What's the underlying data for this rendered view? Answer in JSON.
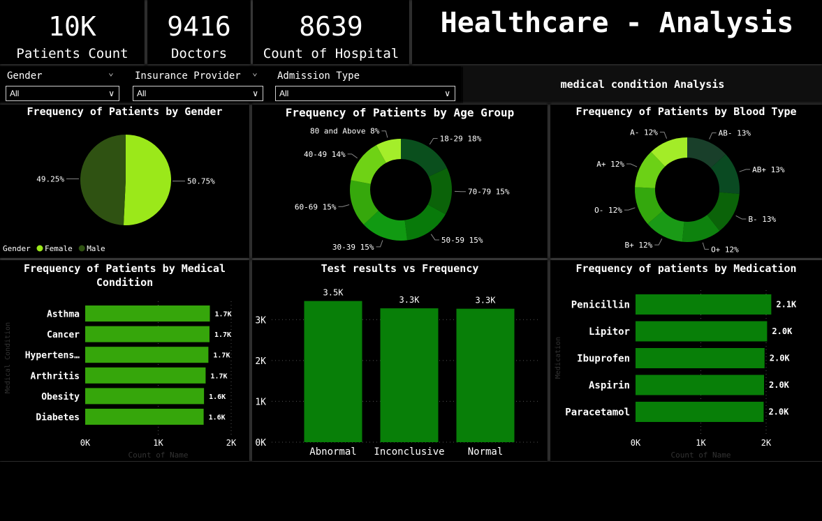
{
  "kpis": [
    {
      "value": "10K",
      "label": "Patients Count"
    },
    {
      "value": "9416",
      "label": "Doctors"
    },
    {
      "value": "8639",
      "label": "Count of Hospital"
    }
  ],
  "page_title": "Healthcare - Analysis",
  "section_label": "medical condition Analysis",
  "filters": [
    {
      "label": "Gender",
      "selected": "All"
    },
    {
      "label": "Insurance Provider",
      "selected": "All"
    },
    {
      "label": "Admission Type",
      "selected": "All"
    }
  ],
  "icons": {
    "dropdown": "chevron-down-icon"
  },
  "colors": {
    "bright_green": "#9be81a",
    "dark_green": "#2f5212",
    "mid_green": "#36a60b",
    "bar_green": "#087f08",
    "bg": "#000000"
  },
  "chart_data": [
    {
      "type": "pie",
      "title": "Frequency of Patients by Gender",
      "legend_title": "Gender",
      "legend_position": "bottom-left",
      "slices": [
        {
          "label": "Female",
          "value": 50.75,
          "display": "50.75%",
          "color": "#9be81a"
        },
        {
          "label": "Male",
          "value": 49.25,
          "display": "49.25%",
          "color": "#2f5212"
        }
      ]
    },
    {
      "type": "pie",
      "donut": true,
      "title": "Frequency of Patients by Age Group",
      "slices": [
        {
          "label": "18-29",
          "value": 18,
          "display": "18-29 18%",
          "color": "#0a4f1d"
        },
        {
          "label": "70-79",
          "value": 15,
          "display": "70-79 15%",
          "color": "#0b6309"
        },
        {
          "label": "50-59",
          "value": 15,
          "display": "50-59 15%",
          "color": "#087a0a"
        },
        {
          "label": "30-39",
          "value": 15,
          "display": "30-39 15%",
          "color": "#119a12"
        },
        {
          "label": "60-69",
          "value": 15,
          "display": "60-69 15%",
          "color": "#36a80c"
        },
        {
          "label": "40-49",
          "value": 14,
          "display": "40-49 14%",
          "color": "#6fd215"
        },
        {
          "label": "80 and Above",
          "value": 8,
          "display": "80 and Above 8%",
          "color": "#a4ee2a"
        }
      ]
    },
    {
      "type": "pie",
      "donut": true,
      "title": "Frequency of Patients by Blood Type",
      "slices": [
        {
          "label": "AB-",
          "value": 13,
          "display": "AB- 13%",
          "color": "#193f2a"
        },
        {
          "label": "AB+",
          "value": 13,
          "display": "AB+ 13%",
          "color": "#0a4a22"
        },
        {
          "label": "B-",
          "value": 13,
          "display": "B- 13%",
          "color": "#0b6309"
        },
        {
          "label": "O+",
          "value": 12,
          "display": "O+ 12%",
          "color": "#0e820e"
        },
        {
          "label": "B+",
          "value": 12,
          "display": "B+ 12%",
          "color": "#1a9a16"
        },
        {
          "label": "O-",
          "value": 12,
          "display": "O- 12%",
          "color": "#34a80d"
        },
        {
          "label": "A+",
          "value": 12,
          "display": "A+ 12%",
          "color": "#6cd116"
        },
        {
          "label": "A-",
          "value": 12,
          "display": "A- 12%",
          "color": "#a3ec28"
        }
      ]
    },
    {
      "type": "bar",
      "orientation": "horizontal",
      "title": "Frequency of Patients by Medical Condition",
      "ylabel": "Medical Condition",
      "xlabel": "Count of Name",
      "categories": [
        "Asthma",
        "Cancer",
        "Hypertens…",
        "Arthritis",
        "Obesity",
        "Diabetes"
      ],
      "values": [
        1708,
        1703,
        1688,
        1650,
        1628,
        1623
      ],
      "data_labels": [
        "1.7K",
        "1.7K",
        "1.7K",
        "1.7K",
        "1.6K",
        "1.6K"
      ],
      "xlim": [
        0,
        2000
      ],
      "ticks": [
        "0K",
        "1K",
        "2K"
      ],
      "color": "#36a60b"
    },
    {
      "type": "bar",
      "orientation": "vertical",
      "title": "Test results vs Frequency",
      "categories": [
        "Abnormal",
        "Inconclusive",
        "Normal"
      ],
      "values": [
        3456,
        3277,
        3267
      ],
      "data_labels": [
        "3.5K",
        "3.3K",
        "3.3K"
      ],
      "ylim": [
        0,
        3500
      ],
      "ticks": [
        "0K",
        "1K",
        "2K",
        "3K"
      ],
      "color": "#087f08"
    },
    {
      "type": "bar",
      "orientation": "horizontal",
      "title": "Frequency of patients by Medication",
      "ylabel": "Medication",
      "xlabel": "Count of Name",
      "categories": [
        "Penicillin",
        "Lipitor",
        "Ibuprofen",
        "Aspirin",
        "Paracetamol"
      ],
      "values": [
        2079,
        2015,
        1976,
        1968,
        1962
      ],
      "data_labels": [
        "2.1K",
        "2.0K",
        "2.0K",
        "2.0K",
        "2.0K"
      ],
      "xlim": [
        0,
        2000
      ],
      "ticks": [
        "0K",
        "1K",
        "2K"
      ],
      "color": "#087f08"
    }
  ]
}
